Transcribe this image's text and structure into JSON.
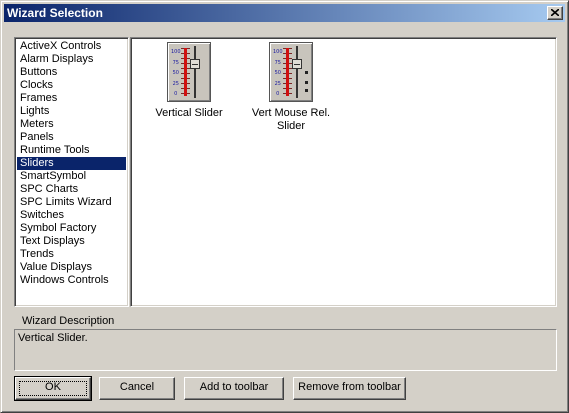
{
  "window": {
    "title": "Wizard Selection"
  },
  "categories": [
    {
      "label": "ActiveX Controls",
      "selected": false
    },
    {
      "label": "Alarm Displays",
      "selected": false
    },
    {
      "label": "Buttons",
      "selected": false
    },
    {
      "label": "Clocks",
      "selected": false
    },
    {
      "label": "Frames",
      "selected": false
    },
    {
      "label": "Lights",
      "selected": false
    },
    {
      "label": "Meters",
      "selected": false
    },
    {
      "label": "Panels",
      "selected": false
    },
    {
      "label": "Runtime Tools",
      "selected": false
    },
    {
      "label": "Sliders",
      "selected": true
    },
    {
      "label": "SmartSymbol",
      "selected": false
    },
    {
      "label": "SPC Charts",
      "selected": false
    },
    {
      "label": "SPC Limits Wizard",
      "selected": false
    },
    {
      "label": "Switches",
      "selected": false
    },
    {
      "label": "Symbol Factory",
      "selected": false
    },
    {
      "label": "Text Displays",
      "selected": false
    },
    {
      "label": "Trends",
      "selected": false
    },
    {
      "label": "Value Displays",
      "selected": false
    },
    {
      "label": "Windows Controls",
      "selected": false
    }
  ],
  "wizards": [
    {
      "label": "Vertical Slider",
      "icon": "vertical-slider-icon",
      "scale": [
        "100",
        "75",
        "50",
        "25",
        "0"
      ]
    },
    {
      "label": "Vert Mouse Rel.\nSlider",
      "icon": "vert-mouse-rel-slider-icon",
      "scale": [
        "100",
        "75",
        "50",
        "25",
        "0"
      ]
    }
  ],
  "description": {
    "label": "Wizard Description",
    "text": "Vertical Slider."
  },
  "buttons": {
    "ok": "OK",
    "cancel": "Cancel",
    "add": "Add to toolbar",
    "remove": "Remove from  toolbar"
  },
  "colors": {
    "selection": "#0a246a",
    "face": "#d4d0c8",
    "title_start": "#0a246a",
    "title_end": "#a6caf0"
  }
}
